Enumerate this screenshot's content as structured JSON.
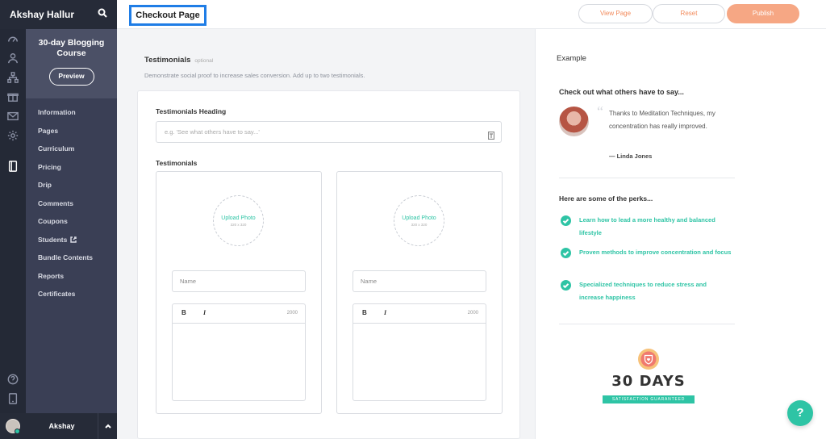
{
  "colors": {
    "accent": "#2ec4a5",
    "publish": "#f6a784",
    "sidebar": "#3a3f55",
    "rail": "#242936",
    "highlight_box": "#1f7de6"
  },
  "sidebar": {
    "user_title": "Akshay Hallur",
    "course_title": "30-day Blogging Course",
    "preview_label": "Preview",
    "items": [
      {
        "label": "Information"
      },
      {
        "label": "Pages"
      },
      {
        "label": "Curriculum"
      },
      {
        "label": "Pricing"
      },
      {
        "label": "Drip"
      },
      {
        "label": "Comments"
      },
      {
        "label": "Coupons"
      },
      {
        "label": "Students"
      },
      {
        "label": "Bundle Contents"
      },
      {
        "label": "Reports"
      },
      {
        "label": "Certificates"
      }
    ],
    "bottom_user": "Akshay"
  },
  "rail_icons": [
    "gauge-icon",
    "users-icon",
    "sitemap-icon",
    "gift-icon",
    "mail-icon",
    "gear-icon",
    "book-icon",
    "help-circle-icon",
    "tablet-icon"
  ],
  "header": {
    "page_title": "Checkout Page",
    "view_label": "View Page",
    "reset_label": "Reset",
    "publish_label": "Publish"
  },
  "testimonials": {
    "title": "Testimonials",
    "optional": "optional",
    "description": "Demonstrate social proof to increase sales conversion. Add up to two testimonials.",
    "heading_label": "Testimonials Heading",
    "heading_placeholder": "e.g. 'See what others have to say...'",
    "list_label": "Testimonials",
    "cards": [
      {
        "upload": "Upload Photo",
        "size": "320 x 320",
        "name_placeholder": "Name",
        "bold": "B",
        "italic": "I",
        "count": "2000"
      },
      {
        "upload": "Upload Photo",
        "size": "320 x 320",
        "name_placeholder": "Name",
        "bold": "B",
        "italic": "I",
        "count": "2000"
      }
    ]
  },
  "example": {
    "label": "Example",
    "heading": "Check out what others have to say...",
    "quote_mark": "“",
    "quote": "Thanks to Meditation Techniques, my concentration has really improved.",
    "author": "— Linda Jones",
    "perks_heading": "Here are some of the perks...",
    "perks": [
      "Learn how to lead a more healthy and balanced lifestyle",
      "Proven methods to improve concentration and focus",
      "Specialized techniques to reduce stress and increase happiness"
    ],
    "badge_days": "30 DAYS",
    "badge_ribbon": "SATISFACTION GUARANTEED"
  },
  "help_label": "?"
}
